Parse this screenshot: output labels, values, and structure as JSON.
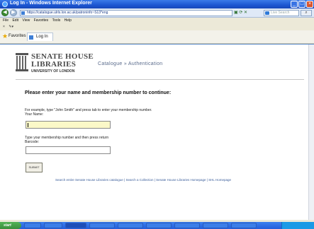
{
  "window": {
    "title": "Log In - Windows Internet Explorer"
  },
  "address_bar": {
    "url": "https://catalogue.ulrls.lon.ac.uk/patroninfo~S13*eng",
    "search_placeholder": "Live Search"
  },
  "menu": {
    "items": [
      "File",
      "Edit",
      "View",
      "Favorites",
      "Tools",
      "Help"
    ]
  },
  "favorites_bar": {
    "label": "Favorites",
    "tab_title": "Log In"
  },
  "page": {
    "logo": {
      "line1": "SENATE HOUSE",
      "line2": "LIBRARIES",
      "line3": "UNIVERSITY OF LONDON"
    },
    "breadcrumb": "Catalogue » Authentication",
    "prompt": "Please enter your name and membership number to continue:",
    "hint": "For example, type \"John Smith\" and press tab to enter your membership number.",
    "name_label": "Your Name:",
    "name_value": "",
    "barcode_hint": "Type your membership number and then press return",
    "barcode_label": "Barcode:",
    "barcode_value": "",
    "submit_label": "SUBMIT",
    "footer_links": "Search entire Senate House Libraries catalogue  |  Search a Collection  |  Senate House Libraries Homepage  |  SHL Homepage"
  },
  "taskbar": {
    "start_label": "start"
  }
}
